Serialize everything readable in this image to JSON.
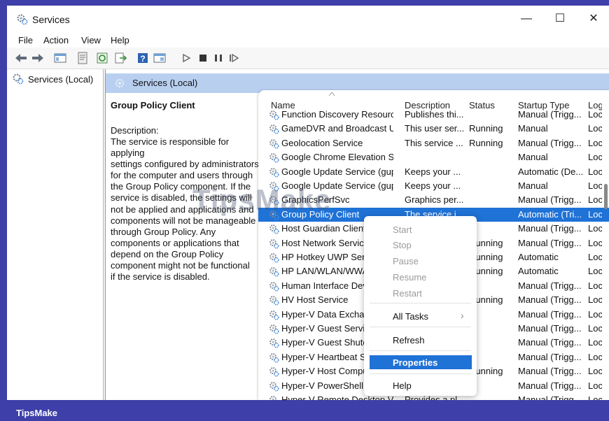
{
  "window": {
    "title": "Services",
    "controls": {
      "minimize": "—",
      "maximize": "☐",
      "close": "✕"
    }
  },
  "menu": [
    "File",
    "Action",
    "View",
    "Help"
  ],
  "toolbar_icons": [
    "back-arrow-icon",
    "forward-arrow-icon",
    "console-tree-icon",
    "properties-icon",
    "refresh-icon",
    "export-list-icon",
    "help-icon",
    "console-icon",
    "play-icon",
    "stop-icon",
    "pause-icon",
    "resume-icon"
  ],
  "tree": {
    "label": "Services (Local)"
  },
  "header": {
    "label": "Services (Local)"
  },
  "selected_service": {
    "name": "Group Policy Client",
    "description_label": "Description:",
    "description_lines": [
      "The service is responsible for applying",
      "settings configured by administrators",
      "for the computer and users through",
      "the Group Policy component. If the",
      "service is disabled, the settings will",
      "not be applied and applications and",
      "components will not be manageable",
      "through Group Policy. Any",
      "components or applications that",
      "depend on the Group Policy",
      "component might not be functional",
      "if the service is disabled."
    ]
  },
  "columns": {
    "name": "Name",
    "description": "Description",
    "status": "Status",
    "startup": "Startup Type",
    "log": "Log"
  },
  "services": [
    {
      "name": "Function Discovery Resourc...",
      "description": "Publishes thi...",
      "status": "",
      "startup": "Manual (Trigg...",
      "log": "Loc"
    },
    {
      "name": "GameDVR and Broadcast Us...",
      "description": "This user ser...",
      "status": "Running",
      "startup": "Manual",
      "log": "Loc"
    },
    {
      "name": "Geolocation Service",
      "description": "This service ...",
      "status": "Running",
      "startup": "Manual (Trigg...",
      "log": "Loc"
    },
    {
      "name": "Google Chrome Elevation Se...",
      "description": "",
      "status": "",
      "startup": "Manual",
      "log": "Loc"
    },
    {
      "name": "Google Update Service (gup...",
      "description": "Keeps your ...",
      "status": "",
      "startup": "Automatic (De...",
      "log": "Loc"
    },
    {
      "name": "Google Update Service (gup...",
      "description": "Keeps your ...",
      "status": "",
      "startup": "Manual",
      "log": "Loc"
    },
    {
      "name": "GraphicsPerfSvc",
      "description": "Graphics per...",
      "status": "",
      "startup": "Manual (Trigg...",
      "log": "Loc"
    },
    {
      "name": "Group Policy Client",
      "description": "The service i...",
      "status": "",
      "startup": "Automatic (Tri...",
      "log": "Loc",
      "selected": true
    },
    {
      "name": "Host Guardian Client",
      "description": "",
      "status": "",
      "startup": "Manual (Trigg...",
      "log": "Loc"
    },
    {
      "name": "Host Network Service",
      "description": "",
      "status": "Running",
      "startup": "Manual (Trigg...",
      "log": "Loc"
    },
    {
      "name": "HP Hotkey UWP Servi",
      "description": "",
      "status": "Running",
      "startup": "Automatic",
      "log": "Loc"
    },
    {
      "name": "HP LAN/WLAN/WWAN",
      "description": "",
      "status": "Running",
      "startup": "Automatic",
      "log": "Loc"
    },
    {
      "name": "Human Interface Dev",
      "description": "",
      "status": "",
      "startup": "Manual (Trigg...",
      "log": "Loc"
    },
    {
      "name": "HV Host Service",
      "description": "",
      "status": "Running",
      "startup": "Manual (Trigg...",
      "log": "Loc"
    },
    {
      "name": "Hyper-V Data Exchan",
      "description": "",
      "status": "",
      "startup": "Manual (Trigg...",
      "log": "Loc"
    },
    {
      "name": "Hyper-V Guest Servic",
      "description": "",
      "status": "",
      "startup": "Manual (Trigg...",
      "log": "Loc"
    },
    {
      "name": "Hyper-V Guest Shutd",
      "description": "",
      "status": "",
      "startup": "Manual (Trigg...",
      "log": "Loc"
    },
    {
      "name": "Hyper-V Heartbeat Se",
      "description": "",
      "status": "",
      "startup": "Manual (Trigg...",
      "log": "Loc"
    },
    {
      "name": "Hyper-V Host Compu",
      "description": "",
      "status": "Running",
      "startup": "Manual (Trigg...",
      "log": "Loc"
    },
    {
      "name": "Hyper-V PowerShell D",
      "description": "",
      "status": "",
      "startup": "Manual (Trigg...",
      "log": "Loc"
    },
    {
      "name": "Hyper-V Remote Desktop Vi...",
      "description": "Provides a pl...",
      "status": "",
      "startup": "Manual (Trigg...",
      "log": "Loc"
    }
  ],
  "context_menu": {
    "start": "Start",
    "stop": "Stop",
    "pause": "Pause",
    "resume": "Resume",
    "restart": "Restart",
    "all_tasks": "All Tasks",
    "all_tasks_arrow": "›",
    "refresh": "Refresh",
    "properties": "Properties",
    "help": "Help"
  },
  "watermark": "TipsMake",
  "footer": {
    "brand": "TipsMake"
  },
  "colors": {
    "selection": "#1f72d6",
    "header_strip": "#b8cff0",
    "frame_border": "#3e3fa8"
  }
}
